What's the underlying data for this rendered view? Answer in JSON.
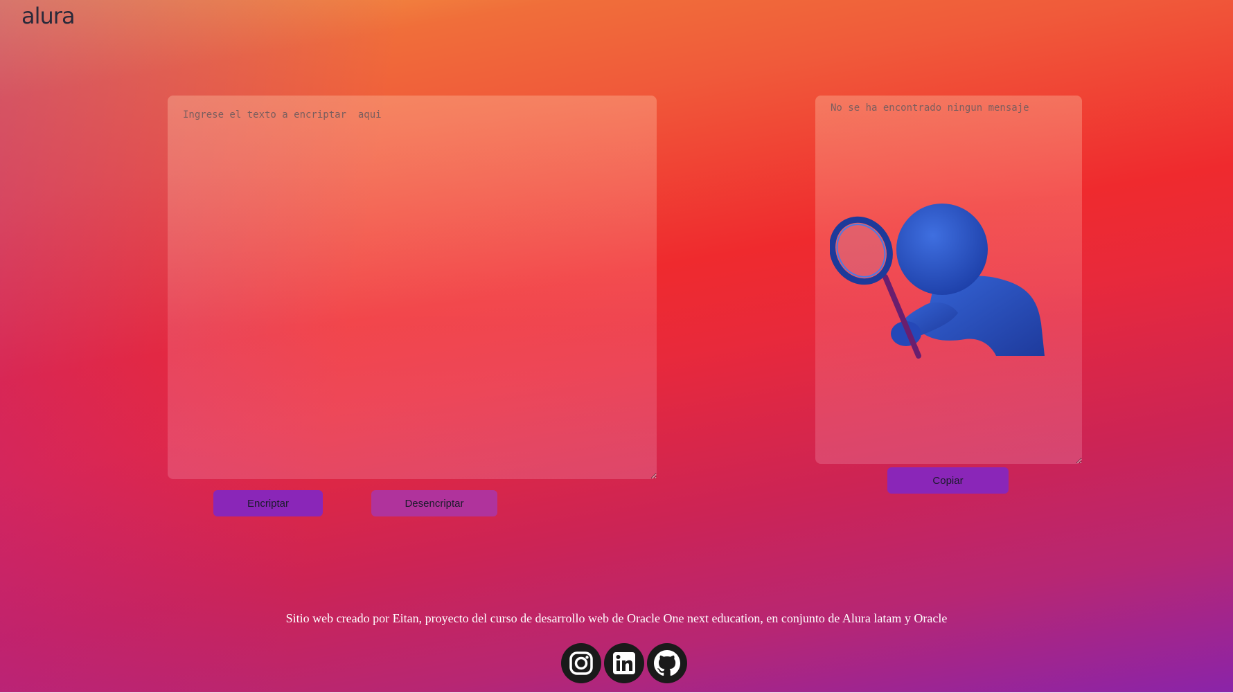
{
  "header": {
    "logo": "alura"
  },
  "encrypt_panel": {
    "input_placeholder": "Ingrese el texto a encriptar  aqui",
    "encrypt_label": "Encriptar",
    "decrypt_label": "Desencriptar"
  },
  "result_panel": {
    "output_placeholder": "No se ha encontrado ningun mensaje",
    "copy_label": "Copiar",
    "illustration": "detective-with-magnifier-figure"
  },
  "footer": {
    "credit": "Sitio web creado por Eitan, proyecto del curso de desarrollo web de Oracle One next education, en conjunto de Alura latam y Oracle",
    "social_icons": [
      "instagram-icon",
      "linkedin-icon",
      "github-icon"
    ]
  },
  "colors": {
    "gradient_top": "#f4a446",
    "gradient_middle": "#ef2a2e",
    "gradient_bottom": "#8a24a9",
    "button_primary": "#8a26b8",
    "button_secondary": "#b0339c",
    "social_bg": "#1a1a1a"
  }
}
